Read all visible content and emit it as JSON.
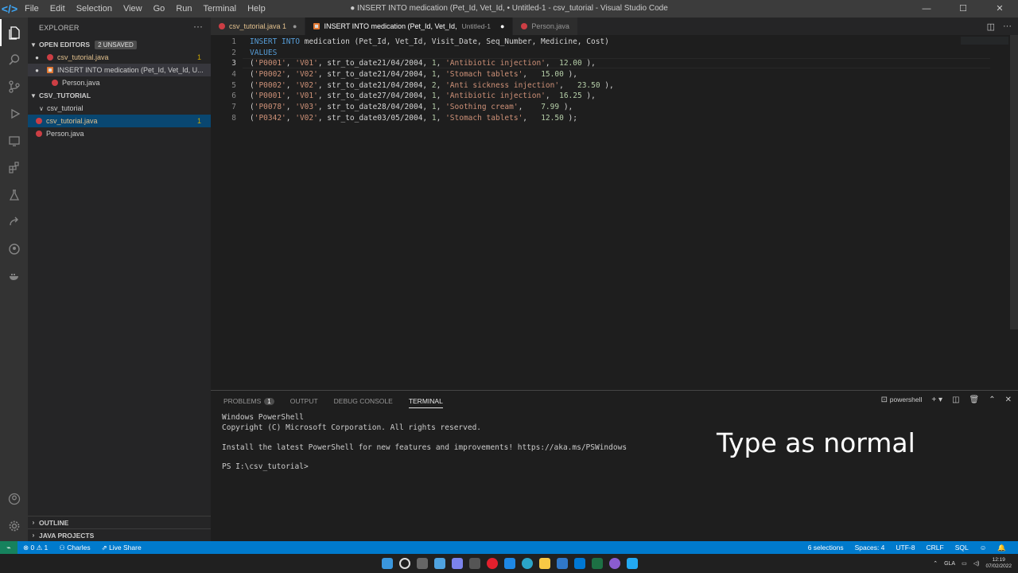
{
  "window": {
    "title": "● INSERT INTO medication (Pet_Id, Vet_Id, • Untitled-1 - csv_tutorial - Visual Studio Code",
    "controls": [
      "—",
      "☐",
      "✕"
    ]
  },
  "menu": [
    "File",
    "Edit",
    "Selection",
    "View",
    "Go",
    "Run",
    "Terminal",
    "Help"
  ],
  "sidebar": {
    "title": "EXPLORER",
    "open_editors": {
      "header": "OPEN EDITORS",
      "badge": "2 UNSAVED",
      "items": [
        {
          "label": "csv_tutorial.java",
          "count": "1"
        },
        {
          "label": "INSERT INTO medication (Pet_Id, Vet_Id,  U..."
        },
        {
          "label": "Person.java"
        }
      ]
    },
    "project": {
      "header": "CSV_TUTORIAL",
      "folder": "csv_tutorial",
      "files": [
        {
          "label": "csv_tutorial.java",
          "count": "1"
        },
        {
          "label": "Person.java"
        }
      ]
    },
    "outline": "OUTLINE",
    "java_projects": "JAVA PROJECTS"
  },
  "tabs": [
    {
      "label": "csv_tutorial.java 1",
      "marker": "●"
    },
    {
      "label": "INSERT INTO medication (Pet_Id, Vet_Id,",
      "sub": "Untitled-1",
      "marker": "●"
    },
    {
      "label": "Person.java"
    }
  ],
  "editor": {
    "line_numbers": [
      "1",
      "2",
      "3",
      "4",
      "5",
      "6",
      "7",
      "8"
    ],
    "line1": {
      "kw1": "INSERT INTO",
      "rest": " medication (Pet_Id, Vet_Id, Visit_Date, Seq_Number, Medicine, Cost)"
    },
    "line2": {
      "kw": "VALUES"
    },
    "rows": [
      {
        "open": "(",
        "pet": "'P0001'",
        "vet": "'V01'",
        "fn": "str_to_date",
        "date": "21/04/2004",
        "seq": "1",
        "med": "'Antibiotic injection'",
        "pad": "  ",
        "cost": "12.00",
        "end": " ),"
      },
      {
        "open": "(",
        "pet": "'P0002'",
        "vet": "'V02'",
        "fn": "str_to_date",
        "date": "21/04/2004",
        "seq": "1",
        "med": "'Stomach tablets'",
        "pad": "   ",
        "cost": "15.00",
        "end": " ),"
      },
      {
        "open": "(",
        "pet": "'P0002'",
        "vet": "'V02'",
        "fn": "str_to_date",
        "date": "21/04/2004",
        "seq": "2",
        "med": "'Anti sickness injection'",
        "pad": "   ",
        "cost": "23.50",
        "end": " ),"
      },
      {
        "open": "(",
        "pet": "'P0001'",
        "vet": "'V01'",
        "fn": "str_to_date",
        "date": "27/04/2004",
        "seq": "1",
        "med": "'Antibiotic injection'",
        "pad": "  ",
        "cost": "16.25",
        "end": " ),"
      },
      {
        "open": "(",
        "pet": "'P0078'",
        "vet": "'V03'",
        "fn": "str_to_date",
        "date": "28/04/2004",
        "seq": "1",
        "med": "'Soothing cream'",
        "pad": "    ",
        "cost": "7.99",
        "end": " ),"
      },
      {
        "open": "(",
        "pet": "'P0342'",
        "vet": "'V02'",
        "fn": "str_to_date",
        "date": "03/05/2004",
        "seq": "1",
        "med": "'Stomach tablets'",
        "pad": "   ",
        "cost": "12.50",
        "end": " );"
      }
    ]
  },
  "panel": {
    "tabs": [
      "PROBLEMS",
      "OUTPUT",
      "DEBUG CONSOLE",
      "TERMINAL"
    ],
    "problems_count": "1",
    "shell": "powershell",
    "terminal_lines": [
      "Windows PowerShell",
      "Copyright (C) Microsoft Corporation. All rights reserved.",
      "",
      "Install the latest PowerShell for new features and improvements! https://aka.ms/PSWindows",
      "",
      "PS I:\\csv_tutorial>"
    ],
    "caption": "Type as normal"
  },
  "statusbar": {
    "remote": "⌁",
    "errors": "⊗ 0 ⚠ 1",
    "user": "Charles",
    "live_share": "Live Share",
    "right": [
      "6 selections",
      "Spaces: 4",
      "UTF-8",
      "CRLF",
      "SQL"
    ]
  },
  "taskbar": {
    "lang": "GLA",
    "time": "12:19",
    "date": "07/02/2022"
  },
  "colors": {
    "accent": "#007acc",
    "keyword": "#569cd6",
    "string": "#ce9178",
    "number": "#b5cea8"
  }
}
